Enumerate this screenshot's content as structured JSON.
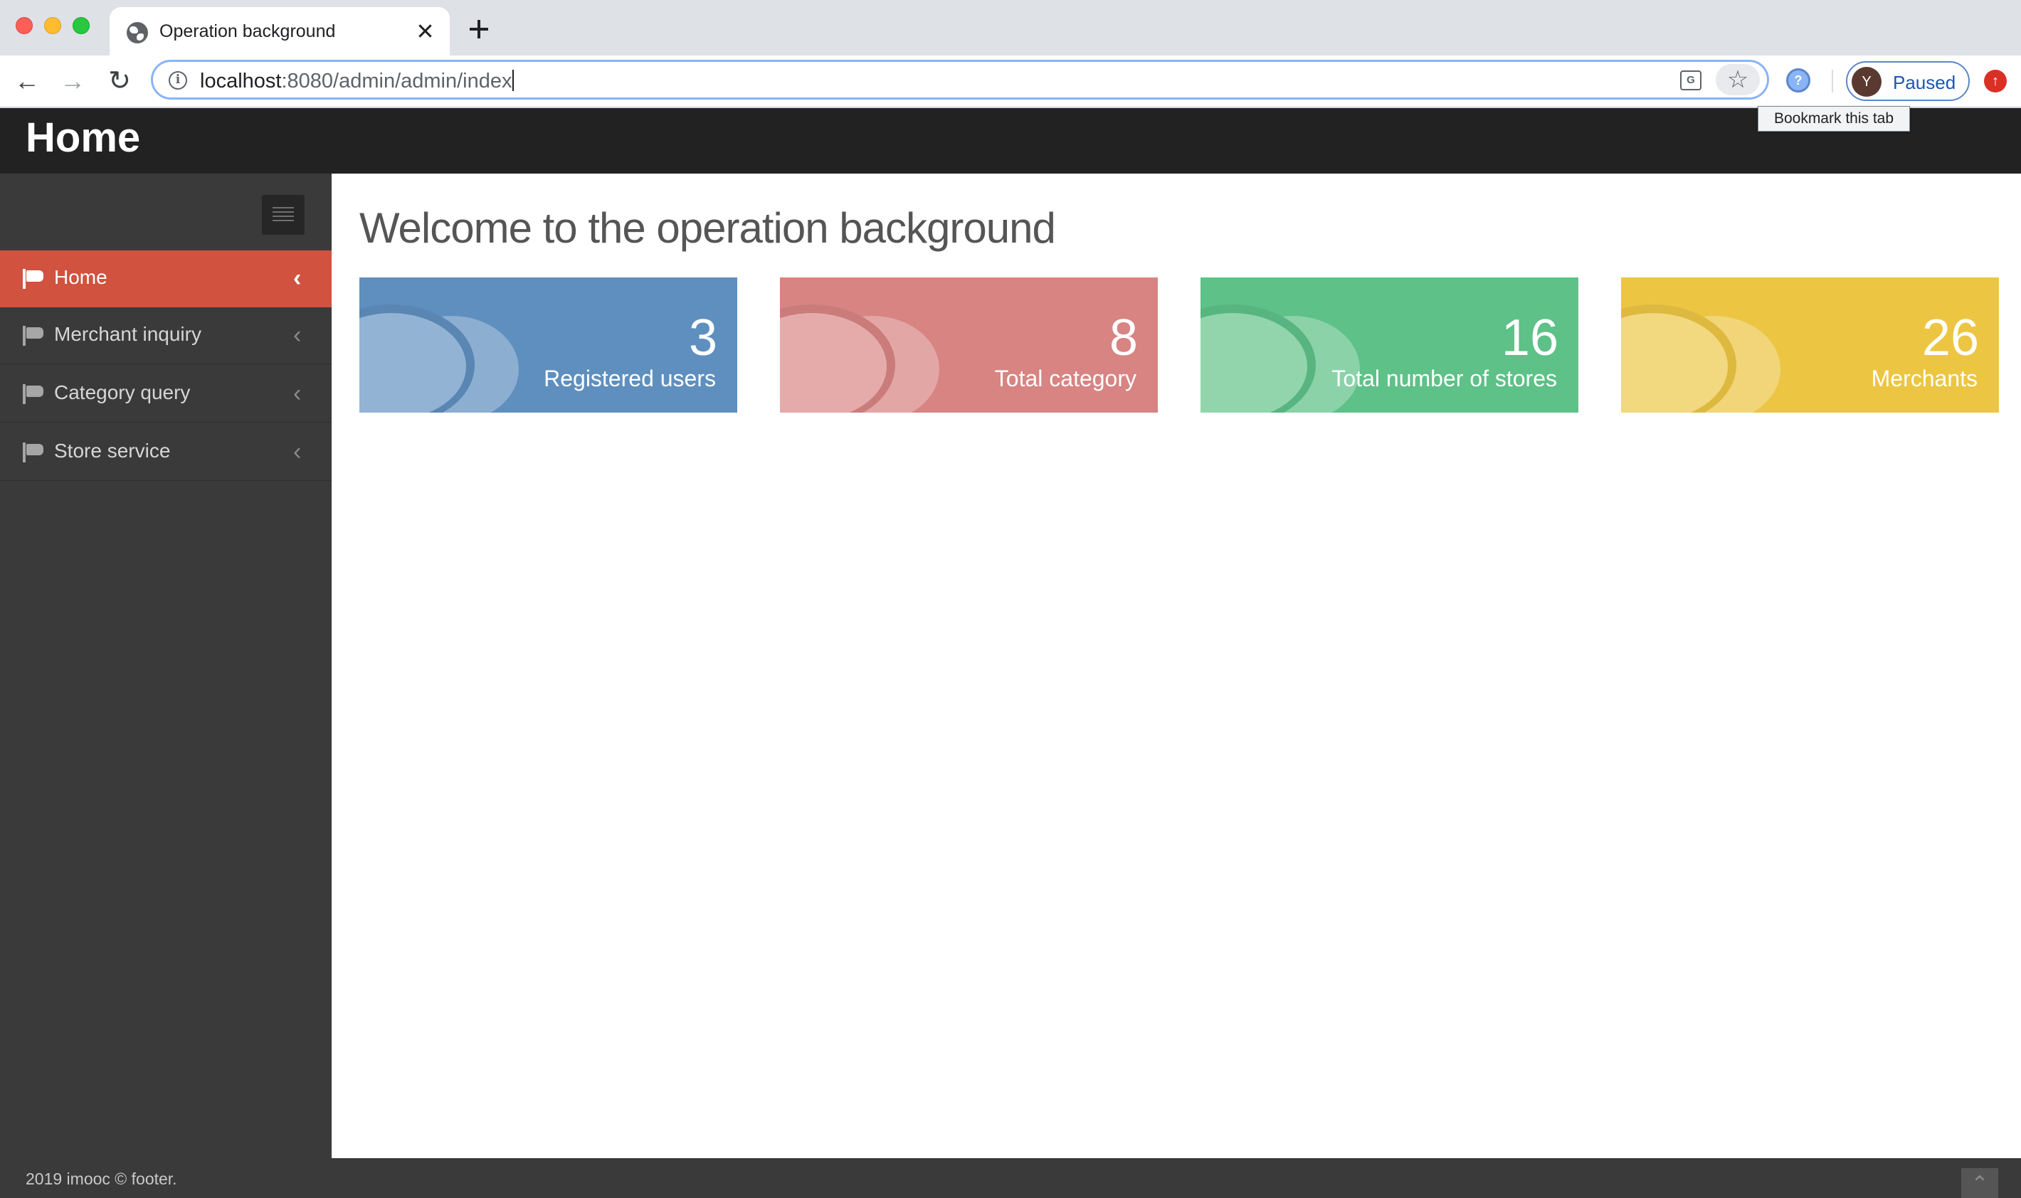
{
  "browser": {
    "tab_title": "Operation background",
    "url_host": "localhost",
    "url_path": ":8080/admin/admin/index",
    "profile_initial": "Y",
    "profile_label": "Paused",
    "tooltip": "Bookmark this tab",
    "icons": [
      "globe-icon",
      "close-icon",
      "plus-icon",
      "back-icon",
      "forward-icon",
      "reload-icon",
      "info-icon",
      "translate-icon",
      "star-icon",
      "extension-icon",
      "update-icon"
    ]
  },
  "header": {
    "brand": "Home"
  },
  "sidebar": {
    "items": [
      {
        "label": "Home",
        "active": true
      },
      {
        "label": "Merchant inquiry",
        "active": false
      },
      {
        "label": "Category query",
        "active": false
      },
      {
        "label": "Store service",
        "active": false
      }
    ]
  },
  "main": {
    "welcome": "Welcome to the operation background",
    "cards": [
      {
        "value": "3",
        "label": "Registered users",
        "color": "#5f8fbe"
      },
      {
        "value": "8",
        "label": "Total category",
        "color": "#d78482"
      },
      {
        "value": "16",
        "label": "Total number of stores",
        "color": "#5ec187"
      },
      {
        "value": "26",
        "label": "Merchants",
        "color": "#ecc543"
      }
    ]
  },
  "footer": {
    "text": "2019 imooc © footer."
  }
}
